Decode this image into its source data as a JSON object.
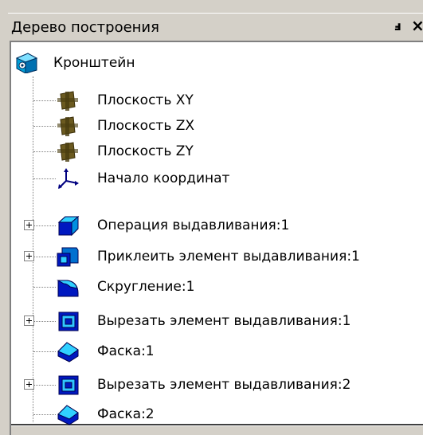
{
  "panel": {
    "title": "Дерево построения",
    "pin_glyph": "ꟼ",
    "close_glyph": "×"
  },
  "tree": {
    "root": {
      "label": "Кронштейн",
      "icon": "part-icon"
    },
    "items": [
      {
        "label": "Плоскость XY",
        "icon": "plane-icon",
        "expandable": false
      },
      {
        "label": "Плоскость ZX",
        "icon": "plane-icon",
        "expandable": false
      },
      {
        "label": "Плоскость ZY",
        "icon": "plane-icon",
        "expandable": false
      },
      {
        "label": "Начало координат",
        "icon": "origin-axes-icon",
        "expandable": false
      },
      {
        "label": "Операция выдавливания:1",
        "icon": "extrude-icon",
        "expandable": true
      },
      {
        "label": "Приклеить элемент выдавливания:1",
        "icon": "boss-extrude-icon",
        "expandable": true
      },
      {
        "label": "Скругление:1",
        "icon": "fillet-icon",
        "expandable": false
      },
      {
        "label": "Вырезать элемент выдавливания:1",
        "icon": "cut-extrude-icon",
        "expandable": true
      },
      {
        "label": "Фаска:1",
        "icon": "chamfer-icon",
        "expandable": false
      },
      {
        "label": "Вырезать элемент выдавливания:2",
        "icon": "cut-extrude-icon",
        "expandable": true
      },
      {
        "label": "Фаска:2",
        "icon": "chamfer-icon",
        "expandable": false
      }
    ]
  }
}
